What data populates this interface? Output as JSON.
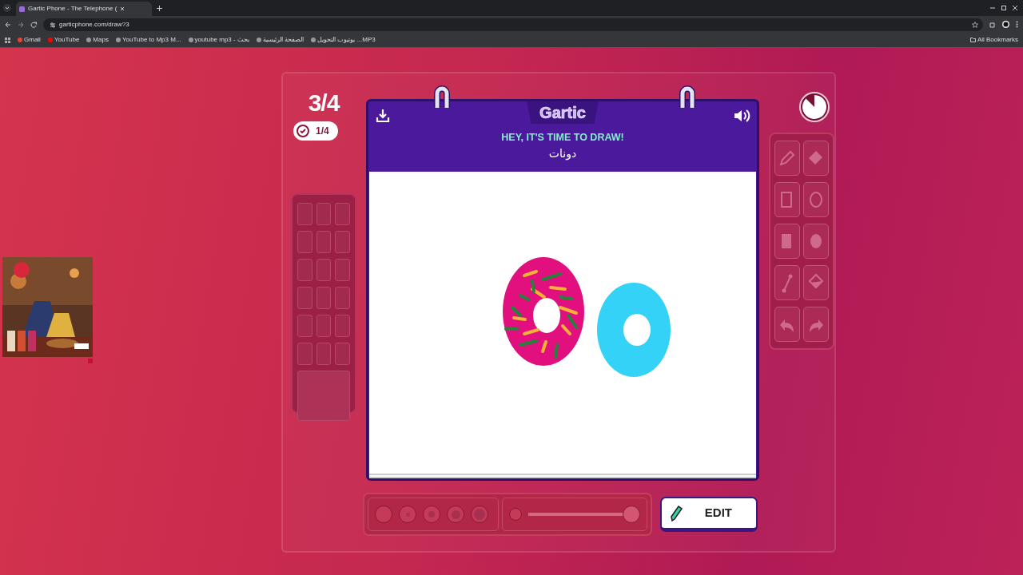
{
  "browser": {
    "tab_title": "Gartic Phone - The Telephone (",
    "url": "garticphone.com/draw?3",
    "bookmarks": [
      "Gmail",
      "YouTube",
      "Maps",
      "YouTube to Mp3 M...",
      "youtube mp3 - بحث",
      "الصفحة الرئيسية",
      "يوتيوب التحويل ...MP3"
    ],
    "all_bookmarks": "All Bookmarks"
  },
  "game": {
    "round": "3/4",
    "done": "1/4",
    "logo": "Gartic",
    "prompt": "HEY, IT'S TIME TO DRAW!",
    "word": "دونات",
    "edit_button": "EDIT"
  },
  "opacity_slider": {
    "level": 1
  }
}
